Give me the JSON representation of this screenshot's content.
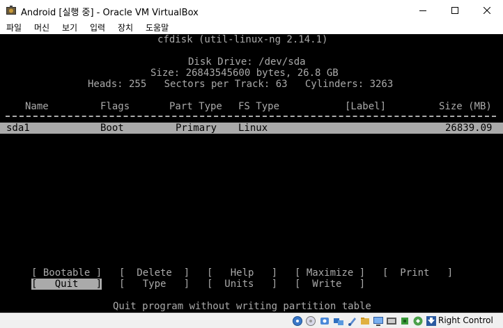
{
  "window": {
    "title": "Android [실행 중] - Oracle VM VirtualBox"
  },
  "menu": [
    "파일",
    "머신",
    "보기",
    "입력",
    "장치",
    "도움말"
  ],
  "cfdisk": {
    "header": "cfdisk (util-linux-ng 2.14.1)",
    "disk_drive": "Disk Drive: /dev/sda",
    "size_line": "Size: 26843545600 bytes, 26.8 GB",
    "geometry_line": "Heads: 255   Sectors per Track: 63   Cylinders: 3263",
    "columns": {
      "name": "Name",
      "flags": "Flags",
      "part_type": "Part Type",
      "fs_type": "FS Type",
      "label": "[Label]",
      "size": "Size (MB)"
    },
    "partitions": [
      {
        "name": "sda1",
        "flags": "Boot",
        "part_type": "Primary",
        "fs_type": "Linux",
        "label": "",
        "size": "26839.09"
      }
    ],
    "menu_buttons": {
      "bootable": "[ Bootable ]",
      "delete": "[  Delete  ]",
      "help": "[   Help   ]",
      "maximize": "[ Maximize ]",
      "print": "[  Print   ]",
      "quit": "[   Quit   ]",
      "type": "[   Type   ]",
      "units": "[  Units   ]",
      "write": "[  Write   ]"
    },
    "status_message": "Quit program without writing partition table"
  },
  "statusbar": {
    "host_key": "Right Control",
    "icons": [
      "hard-disk-icon",
      "optical-drive-icon",
      "audio-icon",
      "network-icon",
      "usb-icon",
      "shared-folder-icon",
      "display-icon",
      "video-capture-icon",
      "cpu-icon",
      "mouse-integration-icon",
      "host-key-arrow-icon"
    ]
  },
  "colors": {
    "console_bg": "#000000",
    "console_fg": "#aaaaaa",
    "highlight_bg": "#aaaaaa",
    "highlight_fg": "#000000"
  }
}
